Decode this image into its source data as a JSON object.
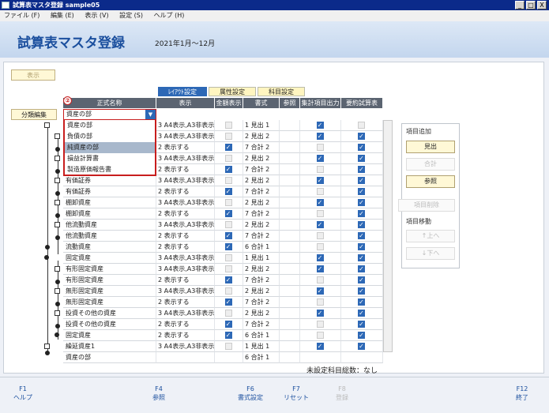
{
  "window": {
    "title": "試算表マスタ登録  sample05",
    "minimize": "_",
    "maximize": "□",
    "close": "X"
  },
  "menu": [
    {
      "label": "ファイル (F)"
    },
    {
      "label": "編集 (E)"
    },
    {
      "label": "表示 (V)"
    },
    {
      "label": "設定 (S)"
    },
    {
      "label": "ヘルプ (H)"
    }
  ],
  "header": {
    "title": "試算表マスタ登録",
    "period": "2021年1月～12月"
  },
  "buttons": {
    "display": "表示",
    "classify": "分類編集"
  },
  "tabs": [
    {
      "label": "ﾚｲｱｳﾄ設定",
      "active": true
    },
    {
      "label": "属性設定",
      "active": false
    },
    {
      "label": "科目設定",
      "active": false
    }
  ],
  "columns": {
    "name": "正式名称",
    "disp": "表示",
    "amt": "金額表示",
    "fmt": "書式",
    "ref": "参照",
    "agg": "集計項目出力",
    "sum": "要約試算表"
  },
  "dropdown": {
    "badge": "②",
    "value": "資産の部",
    "arrow": "▼",
    "options": [
      "資産の部",
      "負債の部",
      "純資産の部",
      "損益計算書",
      "製造原価報告書"
    ],
    "selected_index": 2
  },
  "rows": [
    {
      "name": "",
      "disp": "3 A4表示,A3非表示",
      "amt": false,
      "fmt": "1 見出 1",
      "agg": true,
      "sum": false
    },
    {
      "name": "",
      "disp": "3 A4表示,A3非表示",
      "amt": false,
      "fmt": "2 見出 2",
      "agg": true,
      "sum": true
    },
    {
      "name": "",
      "disp": "2 表示する",
      "amt": true,
      "fmt": "7 合計 2",
      "agg": false,
      "sum": true
    },
    {
      "name": "",
      "disp": "3 A4表示,A3非表示",
      "amt": false,
      "fmt": "2 見出 2",
      "agg": true,
      "sum": true
    },
    {
      "name": "",
      "disp": "2 表示する",
      "amt": true,
      "fmt": "7 合計 2",
      "agg": false,
      "sum": true
    },
    {
      "name": "有価証券",
      "disp": "3 A4表示,A3非表示",
      "amt": false,
      "fmt": "2 見出 2",
      "agg": true,
      "sum": true
    },
    {
      "name": "有価証券",
      "disp": "2 表示する",
      "amt": true,
      "fmt": "7 合計 2",
      "agg": false,
      "sum": true
    },
    {
      "name": "棚卸資産",
      "disp": "3 A4表示,A3非表示",
      "amt": false,
      "fmt": "2 見出 2",
      "agg": true,
      "sum": true
    },
    {
      "name": "棚卸資産",
      "disp": "2 表示する",
      "amt": true,
      "fmt": "7 合計 2",
      "agg": false,
      "sum": true
    },
    {
      "name": "他流動資産",
      "disp": "3 A4表示,A3非表示",
      "amt": false,
      "fmt": "2 見出 2",
      "agg": true,
      "sum": true
    },
    {
      "name": "他流動資産",
      "disp": "2 表示する",
      "amt": true,
      "fmt": "7 合計 2",
      "agg": false,
      "sum": true
    },
    {
      "name": "流動資産",
      "disp": "2 表示する",
      "amt": true,
      "fmt": "6 合計 1",
      "agg": false,
      "sum": true
    },
    {
      "name": "固定資産",
      "disp": "3 A4表示,A3非表示",
      "amt": false,
      "fmt": "1 見出 1",
      "agg": true,
      "sum": true
    },
    {
      "name": "有形固定資産",
      "disp": "3 A4表示,A3非表示",
      "amt": false,
      "fmt": "2 見出 2",
      "agg": true,
      "sum": true
    },
    {
      "name": "有形固定資産",
      "disp": "2 表示する",
      "amt": true,
      "fmt": "7 合計 2",
      "agg": false,
      "sum": true
    },
    {
      "name": "無形固定資産",
      "disp": "3 A4表示,A3非表示",
      "amt": false,
      "fmt": "2 見出 2",
      "agg": true,
      "sum": true
    },
    {
      "name": "無形固定資産",
      "disp": "2 表示する",
      "amt": true,
      "fmt": "7 合計 2",
      "agg": false,
      "sum": true
    },
    {
      "name": "投資その他の資産",
      "disp": "3 A4表示,A3非表示",
      "amt": false,
      "fmt": "2 見出 2",
      "agg": true,
      "sum": true
    },
    {
      "name": "投資その他の資産",
      "disp": "2 表示する",
      "amt": true,
      "fmt": "7 合計 2",
      "agg": false,
      "sum": true
    },
    {
      "name": "固定資産",
      "disp": "2 表示する",
      "amt": true,
      "fmt": "6 合計 1",
      "agg": false,
      "sum": true
    },
    {
      "name": "繰延資産1",
      "disp": "3 A4表示,A3非表示",
      "amt": false,
      "fmt": "1 見出 1",
      "agg": true,
      "sum": true
    },
    {
      "name": "資産の部",
      "disp": "",
      "amt": null,
      "fmt": "6 合計 1",
      "agg": null,
      "sum": null
    }
  ],
  "side": {
    "add_label": "項目追加",
    "midashi": "見出",
    "gokei": "合計",
    "sansho": "参照",
    "delete": "項目削除",
    "move_label": "項目移動",
    "up": "↑上へ",
    "down": "↓下へ"
  },
  "unset": "未設定科目総数：なし",
  "fkeys": [
    {
      "key": "F1",
      "label": "ヘルプ",
      "enabled": true
    },
    {
      "key": "F4",
      "label": "参照",
      "enabled": true
    },
    {
      "key": "F6",
      "label": "書式設定",
      "enabled": true
    },
    {
      "key": "F7",
      "label": "リセット",
      "enabled": true
    },
    {
      "key": "F8",
      "label": "登録",
      "enabled": false
    },
    {
      "key": "F12",
      "label": "終了",
      "enabled": true
    }
  ]
}
